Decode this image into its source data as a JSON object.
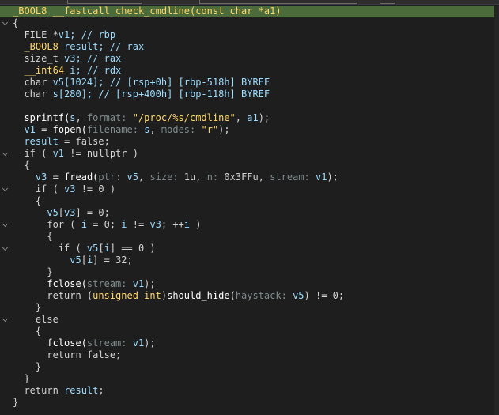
{
  "colors": {
    "background": "#1e1e1e",
    "highlight": "#4c6b3a",
    "keyword": "#d4d4d4",
    "type": "#ffd76b",
    "variable": "#9cdcfe",
    "param_hint": "#7f8c8d"
  },
  "code_lines": [
    {
      "fold": false,
      "highlight": true,
      "tokens": [
        {
          "t": "_BOOL8 __fastcall check_cmdline(const char *a1)",
          "c": "sig"
        }
      ]
    },
    {
      "fold": true,
      "tokens": [
        {
          "t": "{",
          "c": "op"
        }
      ]
    },
    {
      "fold": false,
      "tokens": [
        {
          "t": "  FILE *",
          "c": "kw"
        },
        {
          "t": "v1",
          "c": "var"
        },
        {
          "t": "; // rbp",
          "c": "cmt"
        }
      ]
    },
    {
      "fold": false,
      "tokens": [
        {
          "t": "  _BOOL8 ",
          "c": "type"
        },
        {
          "t": "result",
          "c": "var"
        },
        {
          "t": "; // rax",
          "c": "cmt"
        }
      ]
    },
    {
      "fold": false,
      "tokens": [
        {
          "t": "  size_t ",
          "c": "kw"
        },
        {
          "t": "v3",
          "c": "var"
        },
        {
          "t": "; // rax",
          "c": "cmt"
        }
      ]
    },
    {
      "fold": false,
      "tokens": [
        {
          "t": "  __int64 ",
          "c": "type"
        },
        {
          "t": "i",
          "c": "var"
        },
        {
          "t": "; // rdx",
          "c": "cmt"
        }
      ]
    },
    {
      "fold": false,
      "tokens": [
        {
          "t": "  char ",
          "c": "kw"
        },
        {
          "t": "v5",
          "c": "var"
        },
        {
          "t": "[1024]; // [rsp+0h] [rbp-518h] BYREF",
          "c": "cmt"
        }
      ]
    },
    {
      "fold": false,
      "tokens": [
        {
          "t": "  char ",
          "c": "kw"
        },
        {
          "t": "s",
          "c": "var"
        },
        {
          "t": "[280]; // [rsp+400h] [rbp-118h] BYREF",
          "c": "cmt"
        }
      ]
    },
    {
      "fold": false,
      "tokens": [
        {
          "t": "",
          "c": "op"
        }
      ]
    },
    {
      "fold": false,
      "tokens": [
        {
          "t": "  sprintf(",
          "c": "func"
        },
        {
          "t": "s",
          "c": "var"
        },
        {
          "t": ", ",
          "c": "op"
        },
        {
          "t": "format: ",
          "c": "param"
        },
        {
          "t": "\"/proc/%s/cmdline\"",
          "c": "str"
        },
        {
          "t": ", ",
          "c": "op"
        },
        {
          "t": "a1",
          "c": "var"
        },
        {
          "t": ");",
          "c": "op"
        }
      ]
    },
    {
      "fold": false,
      "tokens": [
        {
          "t": "  v1",
          "c": "var"
        },
        {
          "t": " = ",
          "c": "op"
        },
        {
          "t": "fopen(",
          "c": "func"
        },
        {
          "t": "filename: ",
          "c": "param"
        },
        {
          "t": "s",
          "c": "var"
        },
        {
          "t": ", ",
          "c": "op"
        },
        {
          "t": "modes: ",
          "c": "param"
        },
        {
          "t": "\"r\"",
          "c": "str"
        },
        {
          "t": ");",
          "c": "op"
        }
      ]
    },
    {
      "fold": false,
      "tokens": [
        {
          "t": "  result",
          "c": "var"
        },
        {
          "t": " = false;",
          "c": "op"
        }
      ]
    },
    {
      "fold": true,
      "tokens": [
        {
          "t": "  if ( ",
          "c": "kw"
        },
        {
          "t": "v1",
          "c": "var"
        },
        {
          "t": " != nullptr )",
          "c": "op"
        }
      ]
    },
    {
      "fold": false,
      "tokens": [
        {
          "t": "  {",
          "c": "op"
        }
      ]
    },
    {
      "fold": false,
      "tokens": [
        {
          "t": "    v3",
          "c": "var"
        },
        {
          "t": " = ",
          "c": "op"
        },
        {
          "t": "fread(",
          "c": "func"
        },
        {
          "t": "ptr: ",
          "c": "param"
        },
        {
          "t": "v5",
          "c": "var"
        },
        {
          "t": ", ",
          "c": "op"
        },
        {
          "t": "size: ",
          "c": "param"
        },
        {
          "t": "1u, ",
          "c": "num"
        },
        {
          "t": "n: ",
          "c": "param"
        },
        {
          "t": "0x3FFu, ",
          "c": "num"
        },
        {
          "t": "stream: ",
          "c": "param"
        },
        {
          "t": "v1",
          "c": "var"
        },
        {
          "t": ");",
          "c": "op"
        }
      ]
    },
    {
      "fold": true,
      "tokens": [
        {
          "t": "    if ( ",
          "c": "kw"
        },
        {
          "t": "v3",
          "c": "var"
        },
        {
          "t": " != 0 )",
          "c": "op"
        }
      ]
    },
    {
      "fold": false,
      "tokens": [
        {
          "t": "    {",
          "c": "op"
        }
      ]
    },
    {
      "fold": false,
      "tokens": [
        {
          "t": "      v5",
          "c": "var"
        },
        {
          "t": "[",
          "c": "op"
        },
        {
          "t": "v3",
          "c": "var"
        },
        {
          "t": "] = 0;",
          "c": "op"
        }
      ]
    },
    {
      "fold": true,
      "tokens": [
        {
          "t": "      for ( ",
          "c": "kw"
        },
        {
          "t": "i",
          "c": "var"
        },
        {
          "t": " = 0; ",
          "c": "op"
        },
        {
          "t": "i",
          "c": "var"
        },
        {
          "t": " != ",
          "c": "op"
        },
        {
          "t": "v3",
          "c": "var"
        },
        {
          "t": "; ++",
          "c": "op"
        },
        {
          "t": "i",
          "c": "var"
        },
        {
          "t": " )",
          "c": "op"
        }
      ]
    },
    {
      "fold": false,
      "tokens": [
        {
          "t": "      {",
          "c": "op"
        }
      ]
    },
    {
      "fold": true,
      "tokens": [
        {
          "t": "        if ( ",
          "c": "kw"
        },
        {
          "t": "v5",
          "c": "var"
        },
        {
          "t": "[",
          "c": "op"
        },
        {
          "t": "i",
          "c": "var"
        },
        {
          "t": "] == 0 )",
          "c": "op"
        }
      ]
    },
    {
      "fold": false,
      "tokens": [
        {
          "t": "          v5",
          "c": "var"
        },
        {
          "t": "[",
          "c": "op"
        },
        {
          "t": "i",
          "c": "var"
        },
        {
          "t": "] = 32;",
          "c": "op"
        }
      ]
    },
    {
      "fold": false,
      "tokens": [
        {
          "t": "      }",
          "c": "op"
        }
      ]
    },
    {
      "fold": false,
      "tokens": [
        {
          "t": "      fclose(",
          "c": "func"
        },
        {
          "t": "stream: ",
          "c": "param"
        },
        {
          "t": "v1",
          "c": "var"
        },
        {
          "t": ");",
          "c": "op"
        }
      ]
    },
    {
      "fold": false,
      "tokens": [
        {
          "t": "      return (",
          "c": "kw"
        },
        {
          "t": "unsigned int",
          "c": "type"
        },
        {
          "t": ")",
          "c": "op"
        },
        {
          "t": "should_hide",
          "c": "func"
        },
        {
          "t": "(",
          "c": "op"
        },
        {
          "t": "haystack: ",
          "c": "param"
        },
        {
          "t": "v5",
          "c": "var"
        },
        {
          "t": ") != 0;",
          "c": "op"
        }
      ]
    },
    {
      "fold": false,
      "tokens": [
        {
          "t": "    }",
          "c": "op"
        }
      ]
    },
    {
      "fold": true,
      "tokens": [
        {
          "t": "    else",
          "c": "kw"
        }
      ]
    },
    {
      "fold": false,
      "tokens": [
        {
          "t": "    {",
          "c": "op"
        }
      ]
    },
    {
      "fold": false,
      "tokens": [
        {
          "t": "      fclose(",
          "c": "func"
        },
        {
          "t": "stream: ",
          "c": "param"
        },
        {
          "t": "v1",
          "c": "var"
        },
        {
          "t": ");",
          "c": "op"
        }
      ]
    },
    {
      "fold": false,
      "tokens": [
        {
          "t": "      return false;",
          "c": "kw"
        }
      ]
    },
    {
      "fold": false,
      "tokens": [
        {
          "t": "    }",
          "c": "op"
        }
      ]
    },
    {
      "fold": false,
      "tokens": [
        {
          "t": "  }",
          "c": "op"
        }
      ]
    },
    {
      "fold": false,
      "tokens": [
        {
          "t": "  return ",
          "c": "kw"
        },
        {
          "t": "result",
          "c": "var"
        },
        {
          "t": ";",
          "c": "op"
        }
      ]
    },
    {
      "fold": false,
      "tokens": [
        {
          "t": "}",
          "c": "op"
        }
      ]
    }
  ]
}
